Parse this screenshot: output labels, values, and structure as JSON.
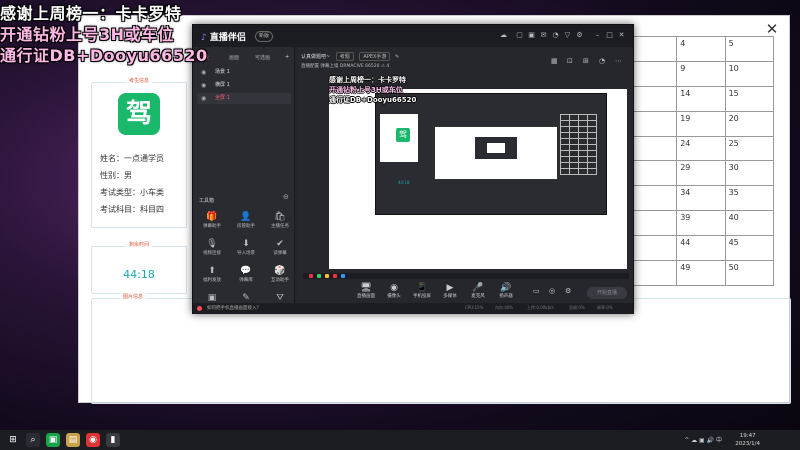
{
  "banner": {
    "line1": "感谢上周榜一：卡卡罗特",
    "line2": "开通钻粉上号3H或车位",
    "line3": "通行证DB+Dooyu66520"
  },
  "exam": {
    "close_glyph": "✕",
    "profile_tag": "考生信息",
    "logo_char": "驾",
    "name_line": "姓名：一点通学员",
    "gender_line": "性别：男",
    "type_line": "考试类型：小车类",
    "subject_line": "考试科目：科目四",
    "timer_tag": "剩余时间",
    "timer_value": "44:18",
    "photo_tag": "图片信息",
    "grid_numbers": [
      [
        "4",
        "5"
      ],
      [
        "9",
        "10"
      ],
      [
        "14",
        "15"
      ],
      [
        "19",
        "20"
      ],
      [
        "24",
        "25"
      ],
      [
        "29",
        "30"
      ],
      [
        "34",
        "35"
      ],
      [
        "39",
        "40"
      ],
      [
        "44",
        "45"
      ],
      [
        "49",
        "50"
      ]
    ]
  },
  "app": {
    "logo_text": "直播伴侣",
    "version": "新版",
    "side_tabs": [
      "场景",
      "画面",
      "可选画"
    ],
    "scenes": [
      "场景 1",
      "横屏 1",
      "全屏 1"
    ],
    "tools_title": "工具箱",
    "tools": [
      {
        "icon": "gift-icon",
        "glyph": "🎁",
        "label": "弹幕助手"
      },
      {
        "icon": "user-icon",
        "glyph": "👤",
        "label": "房管助手"
      },
      {
        "icon": "bag-icon",
        "glyph": "🛍",
        "label": "主播任务"
      },
      {
        "icon": "mic-icon",
        "glyph": "🎙",
        "label": "视频连接"
      },
      {
        "icon": "download-icon",
        "glyph": "⬇",
        "label": "导入场景"
      },
      {
        "icon": "check-icon",
        "glyph": "✔",
        "label": "读弹幕"
      },
      {
        "icon": "upload-icon",
        "glyph": "⬆",
        "label": "福利发放"
      },
      {
        "icon": "message-icon",
        "glyph": "💬",
        "label": "弹幕库"
      },
      {
        "icon": "dice-icon",
        "glyph": "🎲",
        "label": "互动助手"
      },
      {
        "icon": "new-icon",
        "glyph": "▣",
        "label": "更多"
      },
      {
        "icon": "pen-icon",
        "glyph": "✎",
        "label": "画板"
      },
      {
        "icon": "tree-icon",
        "glyph": "⛛",
        "label": "三方"
      }
    ],
    "scene_title": "认真做题吧~",
    "scene_pills": [
      "考题",
      "APEX手游"
    ],
    "toolbar_text": "直播配置  弹幕上墙  DRMACIVE  66520  ⚠ 4",
    "controls": [
      {
        "icon": "screen-icon",
        "glyph": "🖥",
        "label": "直播画面"
      },
      {
        "icon": "camera-icon",
        "glyph": "◉",
        "label": "摄像头"
      },
      {
        "icon": "phone-icon",
        "glyph": "📱",
        "label": "手机投屏"
      },
      {
        "icon": "play-icon",
        "glyph": "▶",
        "label": "多媒体"
      },
      {
        "icon": "microphone-icon",
        "glyph": "🎤",
        "label": "麦克风"
      },
      {
        "icon": "speaker-icon",
        "glyph": "🔊",
        "label": "扬声器"
      }
    ],
    "start_live": "开始直播",
    "bottom_text": "如何把手机直播画面接入？",
    "stats": [
      "CPU:15%",
      "内存:40%",
      "上传:0.00kb/s",
      "丢帧:0%",
      "帧率:0%"
    ],
    "nested_timer": "44:18"
  },
  "taskbar": {
    "tray_text": "^ ☁ ▣ 🔊 中",
    "time": "19:47",
    "date": "2023/1/4"
  }
}
